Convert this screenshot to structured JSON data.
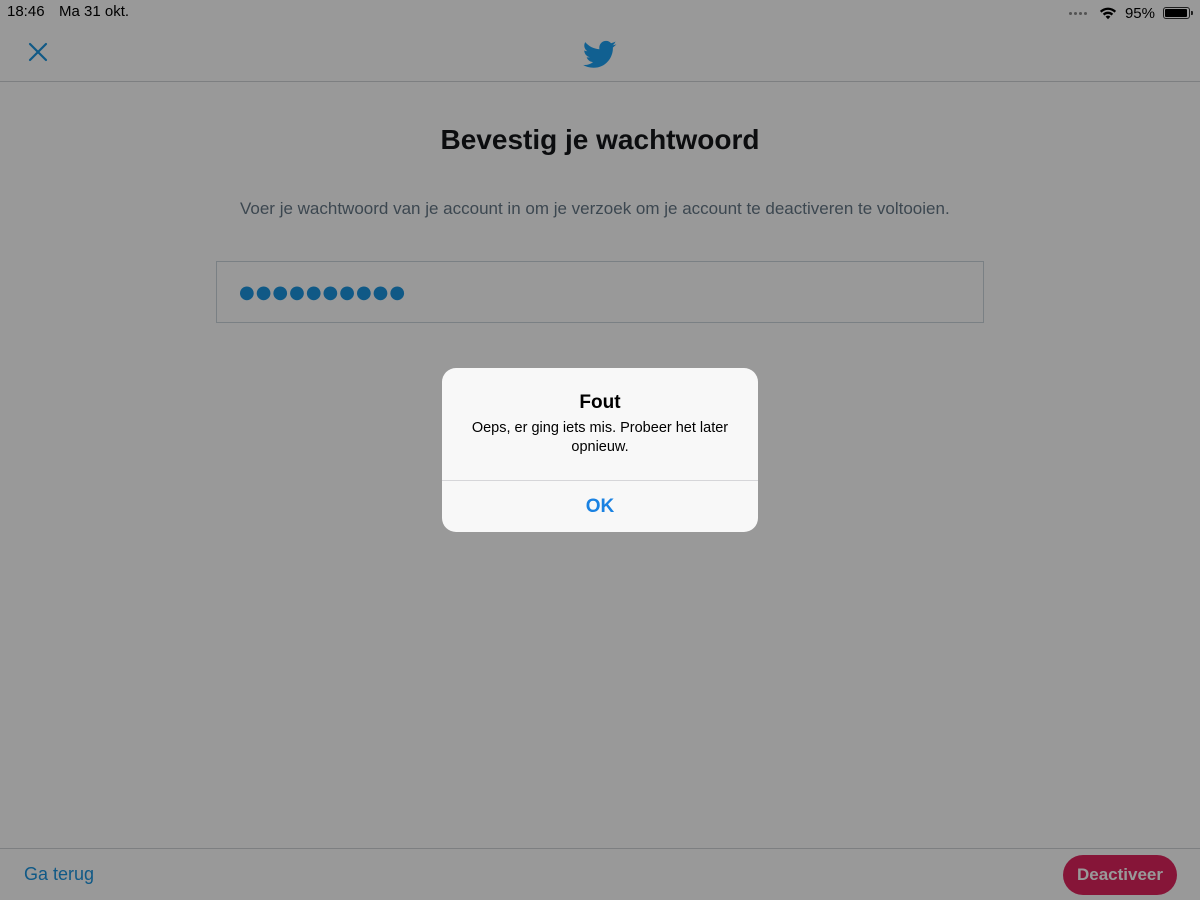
{
  "status_bar": {
    "time": "18:46",
    "date": "Ma 31 okt.",
    "battery_percent": "95%",
    "battery_level": 0.95
  },
  "nav_bar": {
    "close_icon": "close-x-icon",
    "logo_icon": "twitter-bird-icon"
  },
  "main": {
    "title": "Bevestig je wachtwoord",
    "description": "Voer je wachtwoord van je account in om je verzoek om je account te deactiveren te voltooien.",
    "password_value": "●●●●●●●●●●"
  },
  "bottom_bar": {
    "back_label": "Ga terug",
    "deactivate_label": "Deactiveer"
  },
  "alert": {
    "title": "Fout",
    "message": "Oeps, er ging iets mis. Probeer het later opnieuw.",
    "ok_label": "OK"
  },
  "colors": {
    "accent_blue": "#1b95e0",
    "danger_red": "#e0245e",
    "overlay": "rgba(0,0,0,0.4)",
    "alert_bg": "#f8f8f8"
  }
}
